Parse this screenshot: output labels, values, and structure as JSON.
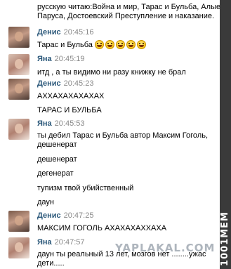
{
  "messages": [
    {
      "text_1": "русскую читаю:Война и мир, Тарас и Бульба, Алые",
      "text_2": "Паруса, Достоевский Преступление и наказание."
    },
    {
      "name": "Денис",
      "time": "20:45:16",
      "lines": [
        "Тарас и Бульба"
      ],
      "emoji_count": 5
    },
    {
      "name": "Яна",
      "time": "20:45:19",
      "lines": [
        "итд , а ты видимо ни разу книжку не брал"
      ]
    },
    {
      "name": "Денис",
      "time": "20:45:23",
      "lines": [
        "АХХАХАХАХАХАХ",
        "ТАРАС И БУЛЬБА"
      ]
    },
    {
      "name": "Яна",
      "time": "20:45:53",
      "lines": [
        "ты дебил Тарас и Бульба автор Максим Гоголь,",
        "дешенерат",
        "дешенерат",
        "дегенерат",
        "тупизм твой убийственный",
        "даун"
      ]
    },
    {
      "name": "Денис",
      "time": "20:47:25",
      "lines": [
        "МАКСИМ ГОГОЛЬ АХАХАХАХХАХА"
      ]
    },
    {
      "name": "Яна",
      "time": "20:47:57",
      "lines": [
        "даун ты реальный 13 лет, мозгов нет ........ужас",
        "дети....."
      ]
    }
  ],
  "watermark": "YAPLAKAL.COM",
  "sidebar_text": "1001MEM"
}
